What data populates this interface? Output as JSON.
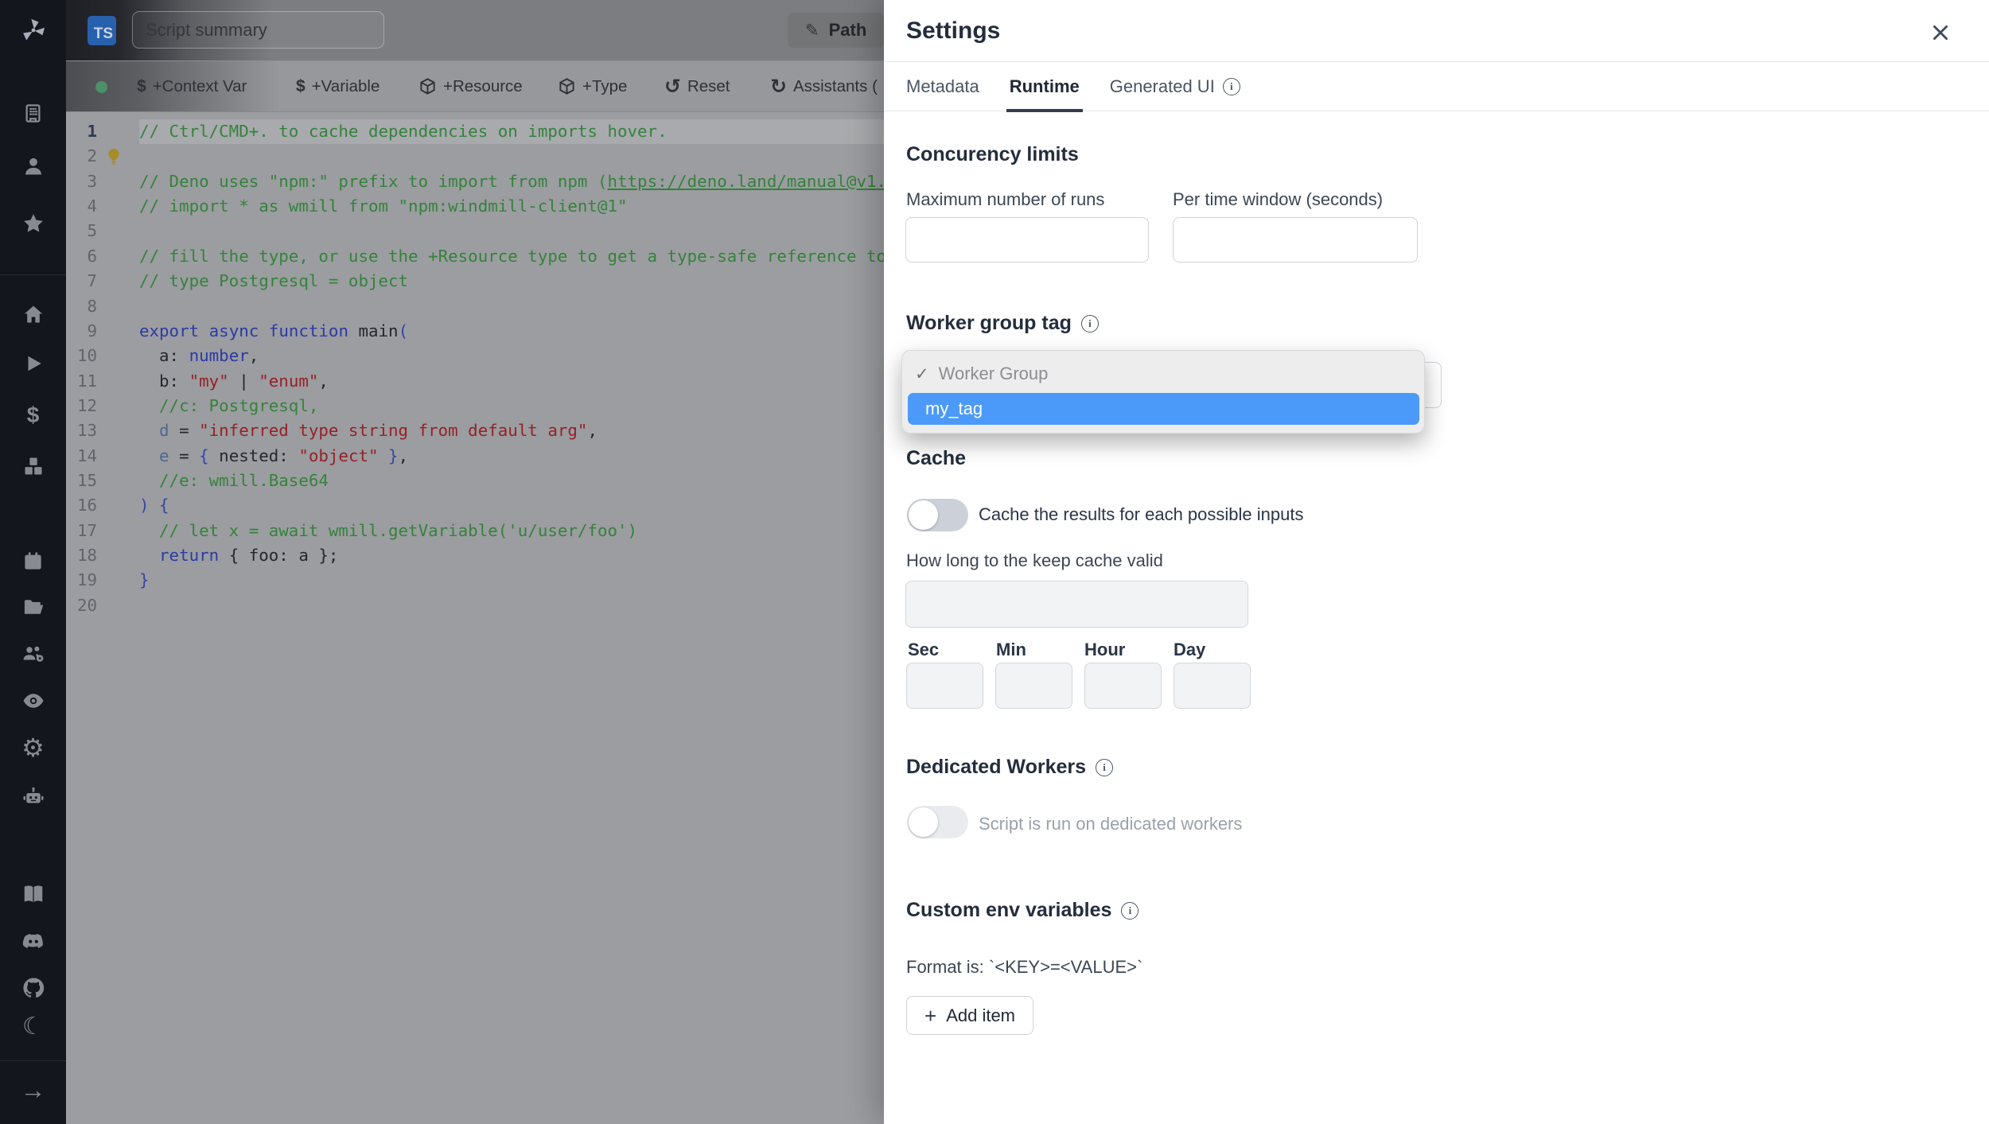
{
  "colors": {
    "accent_blue": "#4b9afa",
    "badge_blue": "#2761ae",
    "status_green": "#4d9066"
  },
  "sidebar": {
    "icons": [
      "windmill-logo",
      "building",
      "person",
      "star",
      "home",
      "play",
      "dollar",
      "boxes",
      "calendar",
      "folder-open",
      "users-gear",
      "eye",
      "gear",
      "robot",
      "book-open",
      "discord",
      "github",
      "moon",
      "arrow-right"
    ]
  },
  "topbar": {
    "language_badge": "TS",
    "summary_placeholder": "Script summary",
    "path_label": "Path",
    "path_icon": "✎"
  },
  "toolbar": {
    "buttons": [
      {
        "icon": "$",
        "label": "+Context Var"
      },
      {
        "icon": "$",
        "label": "+Variable"
      },
      {
        "icon": "box",
        "label": "+Resource"
      },
      {
        "icon": "box",
        "label": "+Type"
      },
      {
        "icon": "↺",
        "label": "Reset"
      },
      {
        "icon": "↻",
        "label": "Assistants ("
      }
    ]
  },
  "editor": {
    "lines": [
      {
        "hl": true,
        "segs": [
          [
            "cm",
            "// Ctrl/CMD+. to cache dependencies on imports hover."
          ]
        ]
      },
      {
        "bulb": true,
        "segs": []
      },
      {
        "segs": [
          [
            "cm",
            "// Deno uses \"npm:\" prefix to import from npm ("
          ],
          [
            "lk",
            "https://deno.land/manual@v1."
          ]
        ]
      },
      {
        "segs": [
          [
            "cm",
            "// import * as wmill from \"npm:windmill-client@1\""
          ]
        ]
      },
      {
        "segs": []
      },
      {
        "segs": [
          [
            "cm",
            "// fill the type, or use the +Resource type to get a type-safe reference to"
          ]
        ]
      },
      {
        "segs": [
          [
            "cm",
            "// type Postgresql = object"
          ]
        ]
      },
      {
        "segs": []
      },
      {
        "segs": [
          [
            "kw",
            "export"
          ],
          [
            "tx",
            " "
          ],
          [
            "kw",
            "async"
          ],
          [
            "tx",
            " "
          ],
          [
            "kw",
            "function"
          ],
          [
            "tx",
            " main"
          ],
          [
            "br",
            "("
          ]
        ]
      },
      {
        "segs": [
          [
            "tx",
            "  a: "
          ],
          [
            "kw",
            "number"
          ],
          [
            "tx",
            ","
          ]
        ]
      },
      {
        "segs": [
          [
            "tx",
            "  b: "
          ],
          [
            "st",
            "\"my\""
          ],
          [
            "tx",
            " | "
          ],
          [
            "st",
            "\"enum\""
          ],
          [
            "tx",
            ","
          ]
        ]
      },
      {
        "segs": [
          [
            "cm",
            "  //c: Postgresql,"
          ]
        ]
      },
      {
        "segs": [
          [
            "pr",
            "  d"
          ],
          [
            "tx",
            " = "
          ],
          [
            "st",
            "\"inferred type string from default arg\""
          ],
          [
            "tx",
            ","
          ]
        ]
      },
      {
        "segs": [
          [
            "pr",
            "  e"
          ],
          [
            "tx",
            " = "
          ],
          [
            "br",
            "{"
          ],
          [
            "tx",
            " nested: "
          ],
          [
            "st",
            "\"object\""
          ],
          [
            "br",
            " }"
          ],
          [
            "tx",
            ","
          ]
        ]
      },
      {
        "segs": [
          [
            "cm",
            "  //e: wmill.Base64"
          ]
        ]
      },
      {
        "segs": [
          [
            "br",
            ") {"
          ]
        ]
      },
      {
        "segs": [
          [
            "cm",
            "  // let x = await wmill.getVariable('u/user/foo')"
          ]
        ]
      },
      {
        "segs": [
          [
            "kw",
            "  return"
          ],
          [
            "tx",
            " { foo: a };"
          ]
        ]
      },
      {
        "segs": [
          [
            "br",
            "}"
          ]
        ]
      },
      {
        "segs": []
      }
    ]
  },
  "settings": {
    "title": "Settings",
    "tabs": [
      {
        "label": "Metadata"
      },
      {
        "label": "Runtime"
      },
      {
        "label": "Generated UI"
      }
    ],
    "concurrency": {
      "heading": "Concurency limits",
      "max_label": "Maximum number of runs",
      "window_label": "Per time window (seconds)"
    },
    "worker_group": {
      "heading": "Worker group tag",
      "options": [
        "Worker Group",
        "my_tag"
      ],
      "selected": "Worker Group",
      "highlighted": "my_tag",
      "check_icon": "✓"
    },
    "cache": {
      "heading": "Cache",
      "toggle_label": "Cache the results for each possible inputs",
      "toggle_on": false,
      "duration_label": "How long to the keep cache valid",
      "units": [
        "Sec",
        "Min",
        "Hour",
        "Day"
      ]
    },
    "dedicated": {
      "heading": "Dedicated Workers",
      "toggle_label": "Script is run on dedicated workers",
      "toggle_on": false
    },
    "env": {
      "heading": "Custom env variables",
      "format_text": "Format is: `<KEY>=<VALUE>`",
      "add_label": "Add item",
      "add_icon": "+"
    }
  }
}
